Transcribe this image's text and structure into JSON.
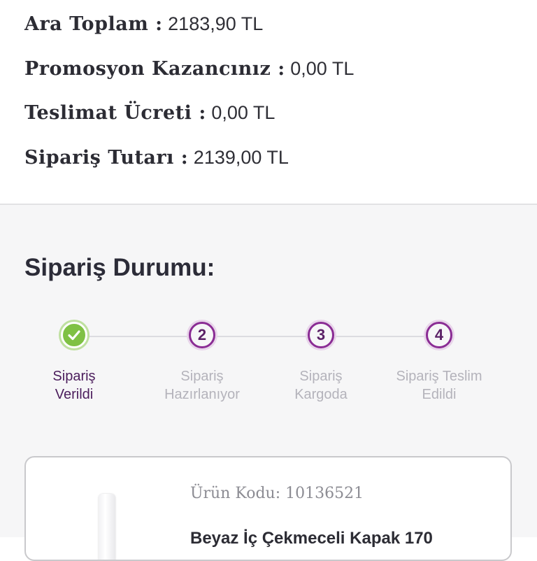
{
  "order_summary": {
    "subtotal": {
      "label": "Ara Toplam :",
      "value": "2183,90 TL"
    },
    "promotion": {
      "label": "Promosyon Kazancınız :",
      "value": "0,00 TL"
    },
    "delivery": {
      "label": "Teslimat Ücreti :",
      "value": "0,00 TL"
    },
    "total": {
      "label": "Sipariş Tutarı :",
      "value": "2139,00 TL"
    }
  },
  "order_status": {
    "title": "Sipariş Durumu:",
    "steps": [
      {
        "number": "",
        "line1": "Sipariş",
        "line2": "Verildi",
        "state": "done"
      },
      {
        "number": "2",
        "line1": "Sipariş",
        "line2": "Hazırlanıyor",
        "state": "pending"
      },
      {
        "number": "3",
        "line1": "Sipariş",
        "line2": "Kargoda",
        "state": "pending"
      },
      {
        "number": "4",
        "line1": "Sipariş Teslim",
        "line2": "Edildi",
        "state": "pending"
      }
    ],
    "colors": {
      "done": "#7fc144",
      "accent": "#8a2c94",
      "active_text": "#4b1d5c",
      "inactive_text": "#b4b3bb"
    }
  },
  "product": {
    "code_label": "Ürün Kodu:",
    "code_value": "10136521",
    "name": "Beyaz İç Çekmeceli Kapak 170"
  },
  "icons": {
    "completed_step": "check-icon"
  }
}
